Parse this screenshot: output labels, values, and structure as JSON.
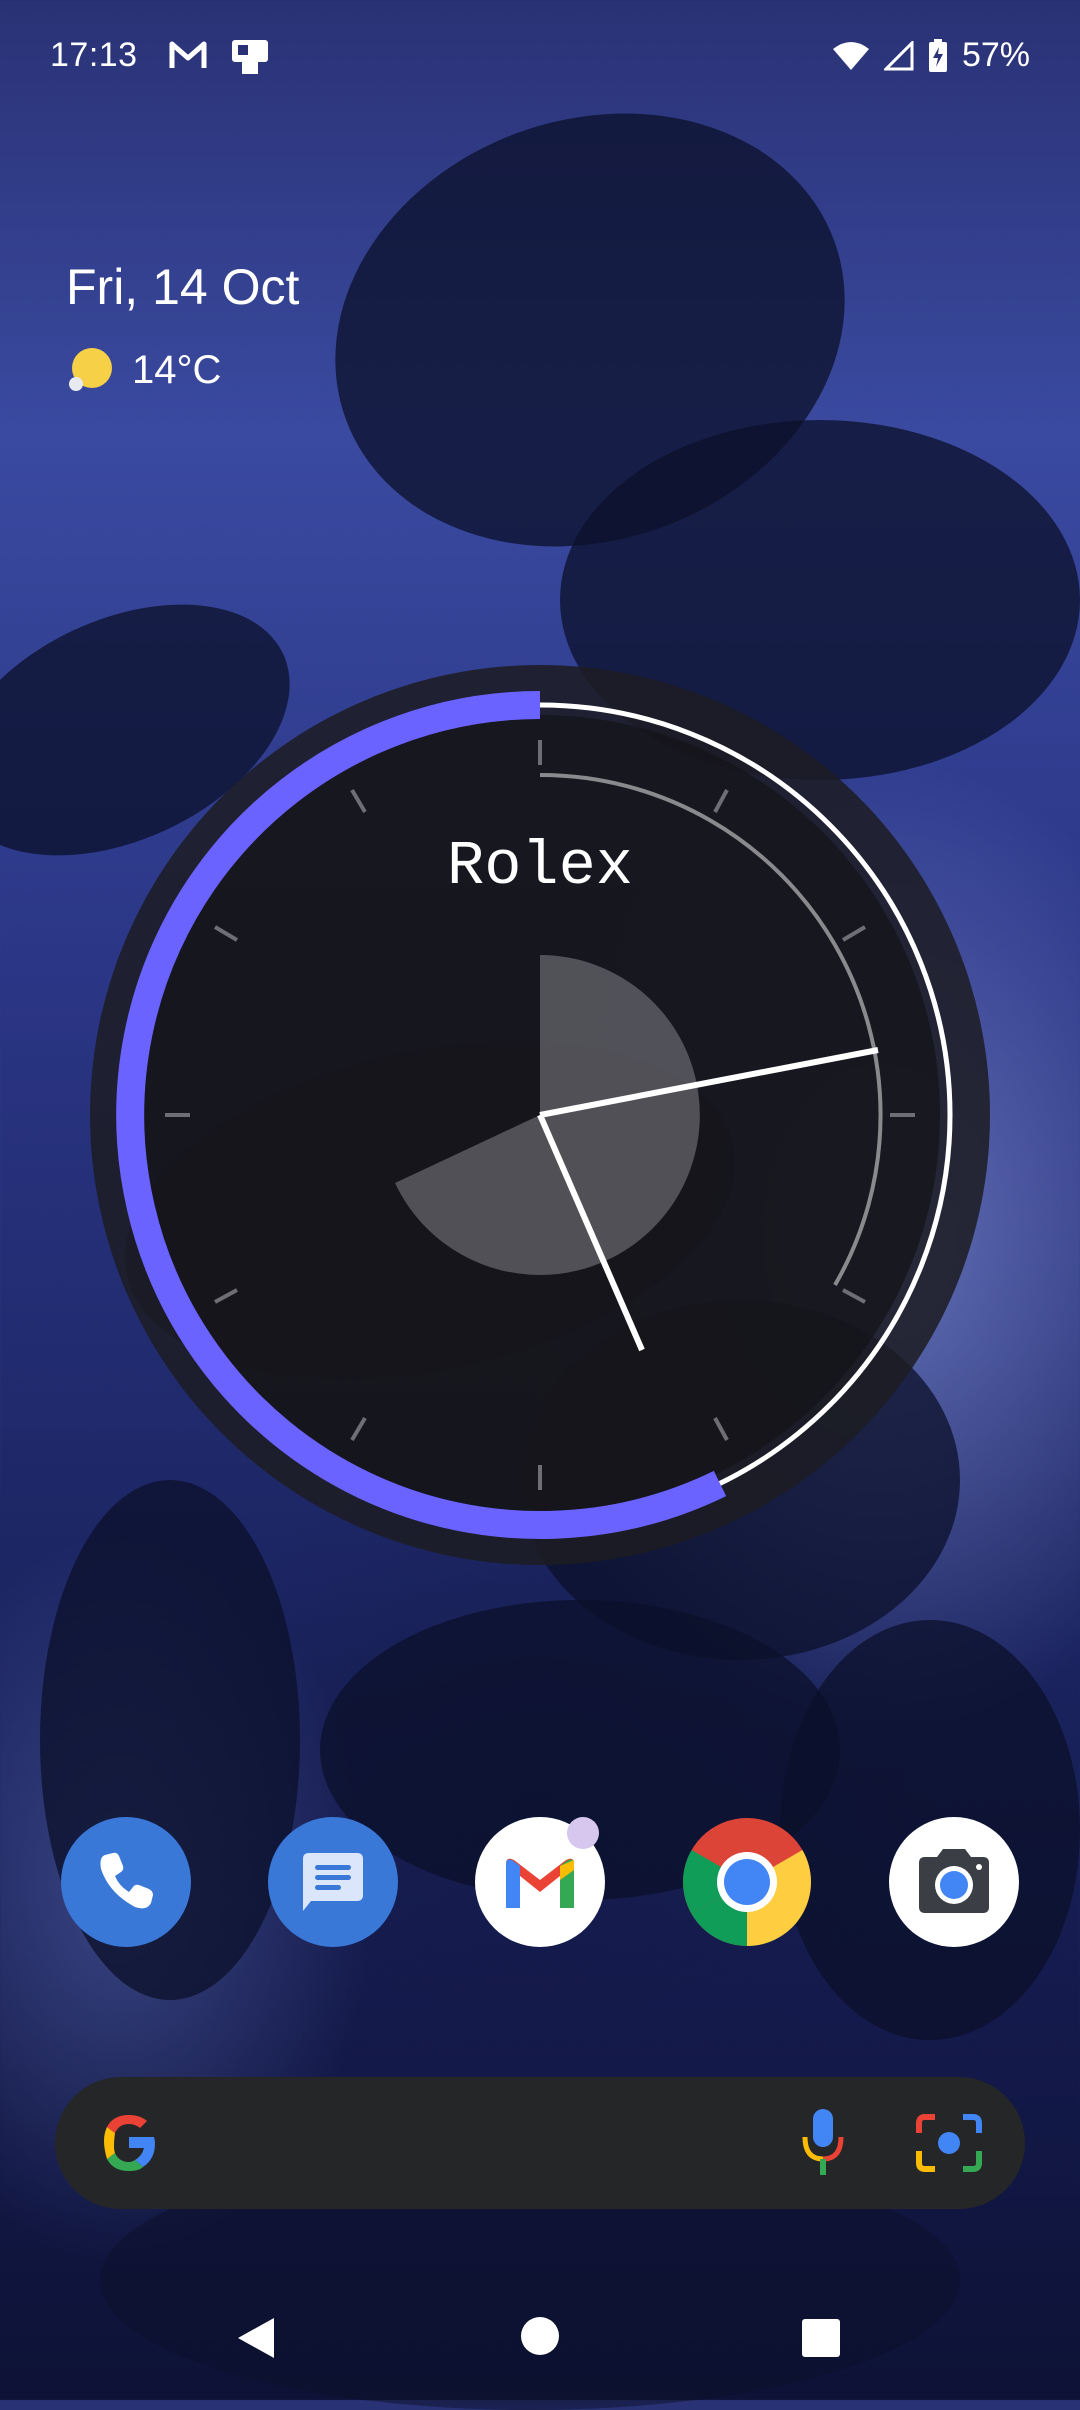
{
  "status_bar": {
    "time": "17:13",
    "battery_percent": "57%"
  },
  "notifications": [
    "gmail-icon",
    "device-notification-icon"
  ],
  "status_icons": [
    "wifi-icon",
    "cell-signal-icon",
    "battery-charging-icon"
  ],
  "at_a_glance": {
    "date": "Fri, 14 Oct",
    "temperature": "14°C",
    "weather_icon": "sunny-icon"
  },
  "clock_widget": {
    "brand": "Rolex",
    "time_shown": "17:13",
    "accent_color": "#6b63ff"
  },
  "dock": {
    "apps": [
      {
        "name": "Phone",
        "icon": "phone-icon",
        "color": "#3a78d8"
      },
      {
        "name": "Messages",
        "icon": "messages-icon",
        "color": "#3a78d8"
      },
      {
        "name": "Gmail",
        "icon": "gmail-icon",
        "color": "#ffffff"
      },
      {
        "name": "Chrome",
        "icon": "chrome-icon",
        "color": "#ffffff"
      },
      {
        "name": "Camera",
        "icon": "camera-icon",
        "color": "#ffffff"
      }
    ]
  },
  "search_bar": {
    "google_icon": "google-g-icon",
    "mic_icon": "mic-icon",
    "lens_icon": "lens-icon"
  },
  "nav_bar": {
    "buttons": [
      "back-button",
      "home-button",
      "recents-button"
    ]
  }
}
